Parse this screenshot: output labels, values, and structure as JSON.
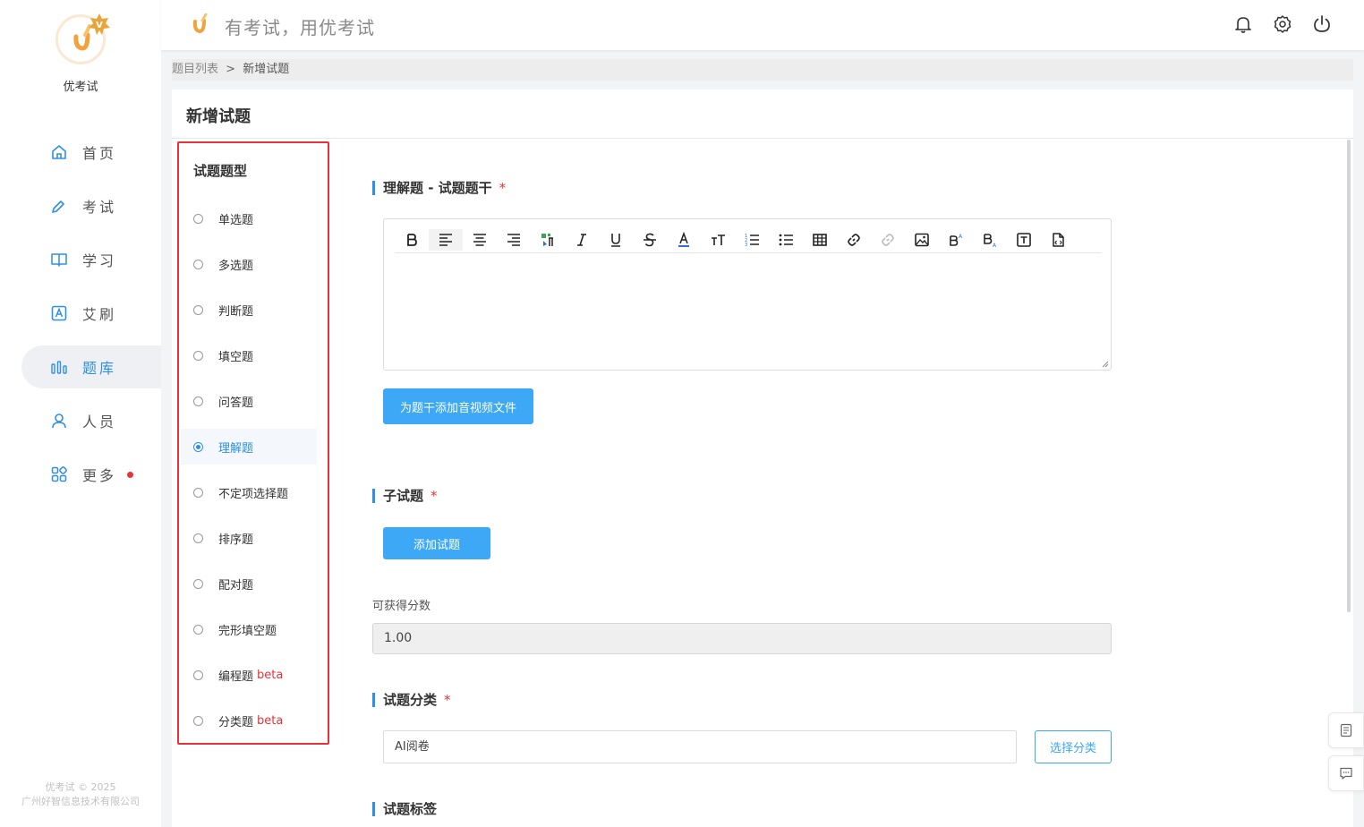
{
  "brand": {
    "name": "优考试",
    "slogan": "有考试，用优考试"
  },
  "nav": [
    {
      "label": "首页",
      "icon": "home-icon"
    },
    {
      "label": "考试",
      "icon": "pen-icon"
    },
    {
      "label": "学习",
      "icon": "book-icon"
    },
    {
      "label": "艾刷",
      "icon": "letter-a-icon"
    },
    {
      "label": "题库",
      "icon": "bar-chart-icon",
      "active": true
    },
    {
      "label": "人员",
      "icon": "user-icon"
    },
    {
      "label": "更多",
      "icon": "apps-icon",
      "badge": "red-dot"
    }
  ],
  "copyright": {
    "line1": "优考试 © 2025",
    "line2": "广州好智信息技术有限公司"
  },
  "header": {
    "icons": [
      "bell-icon",
      "gear-icon",
      "power-icon"
    ]
  },
  "breadcrumb": {
    "parent": "题目列表",
    "separator": ">",
    "current": "新增试题"
  },
  "page_title": "新增试题",
  "question_types": {
    "title": "试题题型",
    "items": [
      {
        "label": "单选题"
      },
      {
        "label": "多选题"
      },
      {
        "label": "判断题"
      },
      {
        "label": "填空题"
      },
      {
        "label": "问答题"
      },
      {
        "label": "理解题",
        "selected": true
      },
      {
        "label": "不定项选择题"
      },
      {
        "label": "排序题"
      },
      {
        "label": "配对题"
      },
      {
        "label": "完形填空题"
      },
      {
        "label": "编程题",
        "tag": "beta"
      },
      {
        "label": "分类题",
        "tag": "beta"
      }
    ]
  },
  "form": {
    "stem_title": "理解题 - 试题题干",
    "required_mark": "*",
    "editor_tools": [
      "bold",
      "align-left",
      "align-center",
      "align-right",
      "format-painter",
      "italic",
      "underline",
      "strikethrough",
      "font-color",
      "font-size",
      "ordered-list",
      "unordered-list",
      "table",
      "link",
      "unlink",
      "image",
      "superscript",
      "subscript",
      "text-box",
      "html-source"
    ],
    "add_media_button": "为题干添加音视频文件",
    "sub_questions_title": "子试题",
    "add_question_button": "添加试题",
    "score_label": "可获得分数",
    "score_value": "1.00",
    "category_title": "试题分类",
    "category_value": "AI阅卷",
    "select_category_button": "选择分类",
    "tags_title": "试题标签"
  },
  "colors": {
    "accent": "#3da8f5",
    "highlight_border": "#e5333a",
    "beta": "#e5333a"
  }
}
